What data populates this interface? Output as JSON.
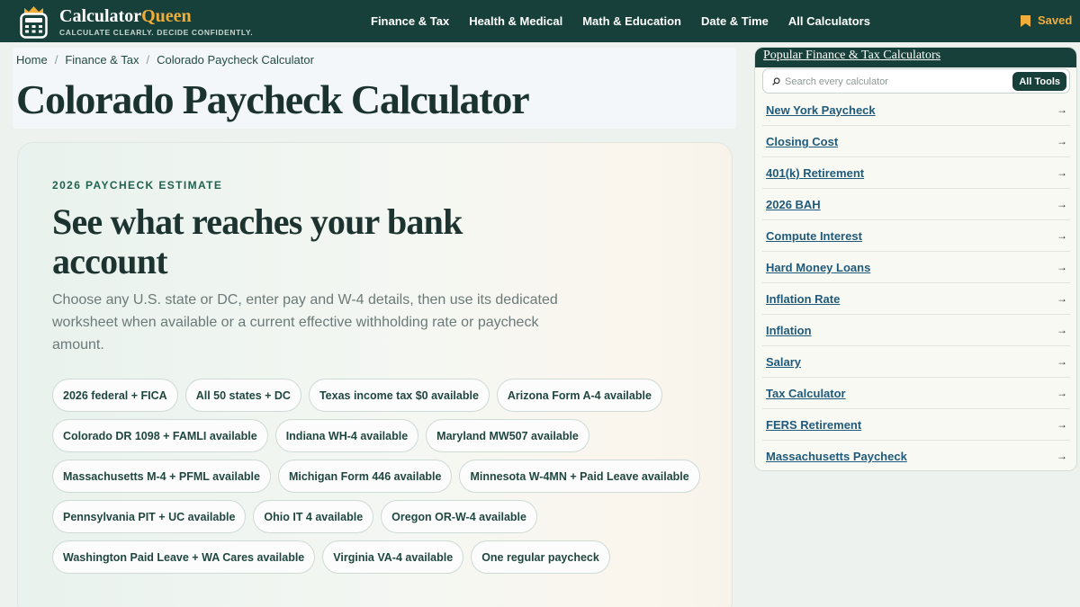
{
  "header": {
    "brand_primary": "Calculator",
    "brand_accent": "Queen",
    "tagline": "CALCULATE CLEARLY. DECIDE CONFIDENTLY.",
    "nav": [
      "Finance & Tax",
      "Health & Medical",
      "Math & Education",
      "Date & Time",
      "All Calculators"
    ],
    "saved_label": "Saved",
    "saved_icon": "bookmark-icon",
    "logo_icon": "calculator-crown-icon"
  },
  "breadcrumb": [
    "Home",
    "Finance & Tax",
    "Colorado Paycheck Calculator"
  ],
  "page_title": "Colorado Paycheck Calculator",
  "hero": {
    "eyebrow": "2026 PAYCHECK ESTIMATE",
    "heading": "See what reaches your bank account",
    "subtitle": "Choose any U.S. state or DC, enter pay and W-4 details, then use its dedicated worksheet when available or a current effective withholding rate or paycheck amount.",
    "chips": [
      "2026 federal + FICA",
      "All 50 states + DC",
      "Texas income tax $0 available",
      "Arizona Form A-4 available",
      "Colorado DR 1098 + FAMLI available",
      "Indiana WH-4 available",
      "Maryland MW507 available",
      "Massachusetts M-4 + PFML available",
      "Michigan Form 446 available",
      "Minnesota W-4MN + Paid Leave available",
      "Pennsylvania PIT + UC available",
      "Ohio IT 4 available",
      "Oregon OR-W-4 available",
      "Washington Paid Leave + WA Cares available",
      "Virginia VA-4 available",
      "One regular paycheck"
    ]
  },
  "sidebar": {
    "title": "Popular Finance & Tax Calculators",
    "search_placeholder": "Search every calculator",
    "search_icon": "search-icon",
    "all_tools_label": "All Tools",
    "arrow": "→",
    "links": [
      "New York Paycheck",
      "Closing Cost",
      "401(k) Retirement",
      "2026 BAH",
      "Compute Interest",
      "Hard Money Loans",
      "Inflation Rate",
      "Inflation",
      "Salary",
      "Tax Calculator",
      "FERS Retirement",
      "Massachusetts Paycheck"
    ]
  },
  "colors": {
    "header_bg": "#17403a",
    "accent_gold": "#f0ad3a",
    "link_blue": "#1f5a7a",
    "eyebrow_green": "#20614f"
  }
}
